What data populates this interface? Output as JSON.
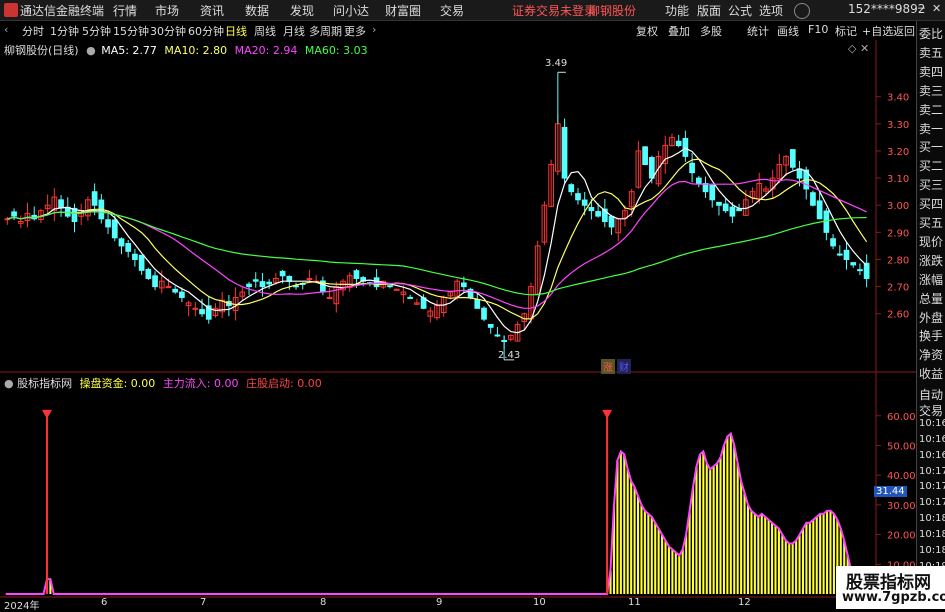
{
  "app": {
    "title": "通达信金融终端",
    "menu": [
      "行情",
      "市场",
      "资讯",
      "数据",
      "发现",
      "问小达",
      "财富圈",
      "交易"
    ],
    "notice": "证券交易未登录",
    "stock_link": "柳钢股份",
    "right_menu": [
      "功能",
      "版面",
      "公式",
      "选项"
    ],
    "user": "152****9892",
    "r_badge": "R"
  },
  "periods": [
    "分时",
    "1分钟",
    "5分钟",
    "15分钟",
    "30分钟",
    "60分钟",
    "日线",
    "周线",
    "月线",
    "多周期",
    "更多"
  ],
  "active_period": "日线",
  "toolbar_right": [
    "复权",
    "叠加",
    "多股",
    "统计",
    "画线",
    "F10",
    "标记",
    "+自选",
    "返回"
  ],
  "main_chart": {
    "stock": "柳钢股份(日线)",
    "ma": [
      {
        "label": "MA5: 2.77",
        "color": "#ffffff"
      },
      {
        "label": "MA10: 2.80",
        "color": "#ffff66"
      },
      {
        "label": "MA20: 2.94",
        "color": "#ff44ff"
      },
      {
        "label": "MA60: 3.03",
        "color": "#44ff44"
      }
    ],
    "annot_high": "3.49",
    "annot_low": "2.43",
    "marks": [
      "涨",
      "财"
    ]
  },
  "indicator": {
    "name": "股标指标网",
    "items": [
      {
        "label": "操盘资金: 0.00",
        "color": "#ffff44"
      },
      {
        "label": "主力流入: 0.00",
        "color": "#ff44ff"
      },
      {
        "label": "庄股启动: 0.00",
        "color": "#ff4444"
      }
    ],
    "current": "31.44"
  },
  "right_panel": [
    "委比",
    "卖五",
    "卖四",
    "卖三",
    "卖二",
    "卖一",
    "买一",
    "买二",
    "买三",
    "买四",
    "买五",
    "现价",
    "涨跌",
    "涨幅",
    "总量",
    "外盘",
    "换手",
    "净资",
    "收益"
  ],
  "right_panel_bottom": [
    "自动",
    "交易",
    "10:16",
    "10:16",
    "10:16",
    "10:17",
    "10:17",
    "10:17",
    "10:18",
    "10:18",
    "10:18",
    "10:19",
    "10:19",
    "10:19"
  ],
  "dates": [
    "2024年",
    "6",
    "7",
    "8",
    "9",
    "10",
    "11",
    "12"
  ],
  "chart_data": [
    {
      "type": "candlestick",
      "title": "柳钢股份(日线)",
      "yticks": [
        2.6,
        2.7,
        2.8,
        2.9,
        3.0,
        3.1,
        3.2,
        3.3,
        3.4
      ],
      "ylim": [
        2.4,
        3.55
      ],
      "close": [
        2.95,
        2.96,
        2.94,
        2.97,
        2.95,
        2.98,
        3.0,
        3.03,
        2.99,
        2.96,
        2.94,
        2.98,
        3.02,
        3.0,
        2.95,
        2.92,
        2.88,
        2.85,
        2.83,
        2.8,
        2.76,
        2.73,
        2.7,
        2.72,
        2.7,
        2.68,
        2.66,
        2.64,
        2.62,
        2.6,
        2.58,
        2.62,
        2.65,
        2.63,
        2.66,
        2.68,
        2.7,
        2.72,
        2.7,
        2.71,
        2.73,
        2.74,
        2.72,
        2.7,
        2.71,
        2.73,
        2.72,
        2.68,
        2.66,
        2.7,
        2.72,
        2.74,
        2.73,
        2.72,
        2.71,
        2.7,
        2.72,
        2.7,
        2.69,
        2.68,
        2.66,
        2.64,
        2.62,
        2.61,
        2.63,
        2.66,
        2.68,
        2.72,
        2.7,
        2.66,
        2.62,
        2.58,
        2.55,
        2.52,
        2.5,
        2.52,
        2.56,
        2.6,
        2.7,
        2.85,
        3.0,
        3.15,
        3.3,
        3.1,
        3.05,
        3.02,
        3.0,
        2.98,
        2.96,
        2.94,
        2.92,
        2.95,
        2.98,
        3.05,
        3.2,
        3.15,
        3.1,
        3.18,
        3.22,
        3.25,
        3.22,
        3.18,
        3.12,
        3.08,
        3.05,
        3.02,
        3.0,
        2.98,
        2.96,
        2.98,
        3.02,
        3.05,
        3.08,
        3.06,
        3.1,
        3.15,
        3.18,
        3.14,
        3.1,
        3.06,
        3.0,
        2.95,
        2.9,
        2.85,
        2.82,
        2.8,
        2.78,
        2.76,
        2.73
      ],
      "high_annotation": 3.49,
      "low_annotation": 2.43,
      "series": [
        {
          "name": "MA5",
          "last": 2.77
        },
        {
          "name": "MA10",
          "last": 2.8
        },
        {
          "name": "MA20",
          "last": 2.94
        },
        {
          "name": "MA60",
          "last": 3.03
        }
      ]
    },
    {
      "type": "bar",
      "title": "股标指标网",
      "yticks": [
        10,
        20,
        30,
        40,
        50,
        60
      ],
      "ylim": [
        0,
        68
      ],
      "values": [
        0,
        0,
        0,
        0,
        0,
        0,
        0,
        0,
        0,
        0,
        0,
        0,
        5,
        5,
        0,
        0,
        0,
        0,
        0,
        0,
        0,
        0,
        0,
        0,
        0,
        0,
        0,
        0,
        0,
        0,
        0,
        0,
        0,
        0,
        0,
        0,
        0,
        0,
        0,
        0,
        0,
        0,
        0,
        0,
        0,
        0,
        0,
        0,
        0,
        0,
        0,
        0,
        0,
        0,
        0,
        0,
        0,
        0,
        0,
        0,
        0,
        0,
        0,
        0,
        0,
        0,
        0,
        0,
        0,
        0,
        0,
        0,
        0,
        0,
        0,
        0,
        0,
        0,
        0,
        0,
        0,
        0,
        0,
        0,
        0,
        0,
        0,
        0,
        0,
        0,
        0,
        0,
        0,
        0,
        0,
        0,
        0,
        0,
        0,
        0,
        0,
        0,
        0,
        0,
        0,
        0,
        0,
        0,
        0,
        0,
        0,
        0,
        0,
        0,
        0,
        0,
        0,
        0,
        0,
        0,
        0,
        0,
        0,
        0,
        0,
        0,
        0,
        0,
        0,
        0,
        0,
        0,
        0,
        0,
        0,
        0,
        0,
        0,
        0,
        0,
        0,
        0,
        0,
        0,
        0,
        0,
        0,
        0,
        0,
        0,
        0,
        0,
        0,
        0,
        0,
        0,
        0,
        0,
        0,
        0,
        0,
        0,
        0,
        0,
        0,
        0,
        0,
        0,
        0,
        0,
        0,
        0,
        0,
        0,
        0,
        0,
        8,
        30,
        45,
        48,
        47,
        42,
        38,
        36,
        33,
        30,
        28,
        27,
        26,
        24,
        22,
        20,
        18,
        16,
        15,
        14,
        13,
        15,
        20,
        28,
        36,
        43,
        47,
        48,
        44,
        42,
        43,
        44,
        46,
        50,
        53,
        54,
        50,
        44,
        38,
        34,
        30,
        28,
        27,
        26,
        27,
        26,
        25,
        24,
        23,
        22,
        20,
        18,
        17,
        17,
        18,
        20,
        22,
        24,
        24,
        25,
        26,
        27,
        27,
        28,
        28,
        27,
        25,
        22,
        18,
        13,
        8,
        3,
        0,
        0,
        0,
        0
      ],
      "current": 31.44
    }
  ],
  "colors": {
    "up": "#ff3333",
    "down": "#55ffff",
    "ma5": "#ffffff",
    "ma10": "#ffff66",
    "ma20": "#ff44ff",
    "ma60": "#44ff44",
    "bar": "#ffff33",
    "envelope": "#ff44ff",
    "spike": "#ff3333"
  },
  "watermark": {
    "line1": "股票指标网",
    "line2": "www.7gpzb.com"
  }
}
